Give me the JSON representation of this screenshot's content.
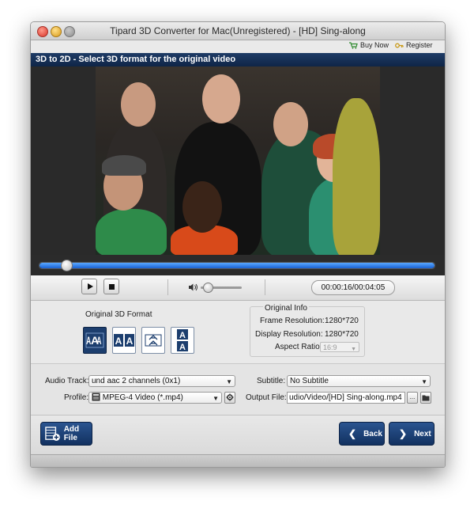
{
  "window": {
    "title": "Tipard 3D Converter for Mac(Unregistered) - [HD] Sing-along"
  },
  "toolbar": {
    "buy_now": "Buy Now",
    "register": "Register"
  },
  "header": {
    "text": "3D to 2D - Select 3D format for the original video"
  },
  "player": {
    "time": "00:00:16/00:04:05",
    "progress": 0.065,
    "volume": 0.1
  },
  "format": {
    "label": "Original 3D Format",
    "buttons": [
      {
        "name": "format-side-by-side-half",
        "glyph": "AA",
        "selected": true
      },
      {
        "name": "format-side-by-side-full",
        "glyph": "AA",
        "selected": false
      },
      {
        "name": "format-top-bottom-half",
        "glyph": "A",
        "selected": false
      },
      {
        "name": "format-top-bottom-full",
        "glyph": "A",
        "selected": false
      }
    ]
  },
  "info": {
    "title": "Original Info",
    "frame_resolution_label": "Frame Resolution:",
    "frame_resolution_value": "1280*720",
    "display_resolution_label": "Display Resolution:",
    "display_resolution_value": "1280*720",
    "aspect_ratio_label": "Aspect Ratio:",
    "aspect_ratio_value": "16:9"
  },
  "settings": {
    "audio_track_label": "Audio Track:",
    "audio_track_value": "und aac 2 channels (0x1)",
    "profile_label": "Profile:",
    "profile_value": "MPEG-4 Video (*.mp4)",
    "subtitle_label": "Subtitle:",
    "subtitle_value": "No Subtitle",
    "output_file_label": "Output File:",
    "output_file_value": "udio/Video/[HD] Sing-along.mp4",
    "browse_label": "..."
  },
  "buttons": {
    "add_file": "Add File",
    "back": "Back",
    "next": "Next"
  },
  "colors": {
    "accent": "#1c3e6e",
    "seek_fill": "#2a7ae8"
  }
}
